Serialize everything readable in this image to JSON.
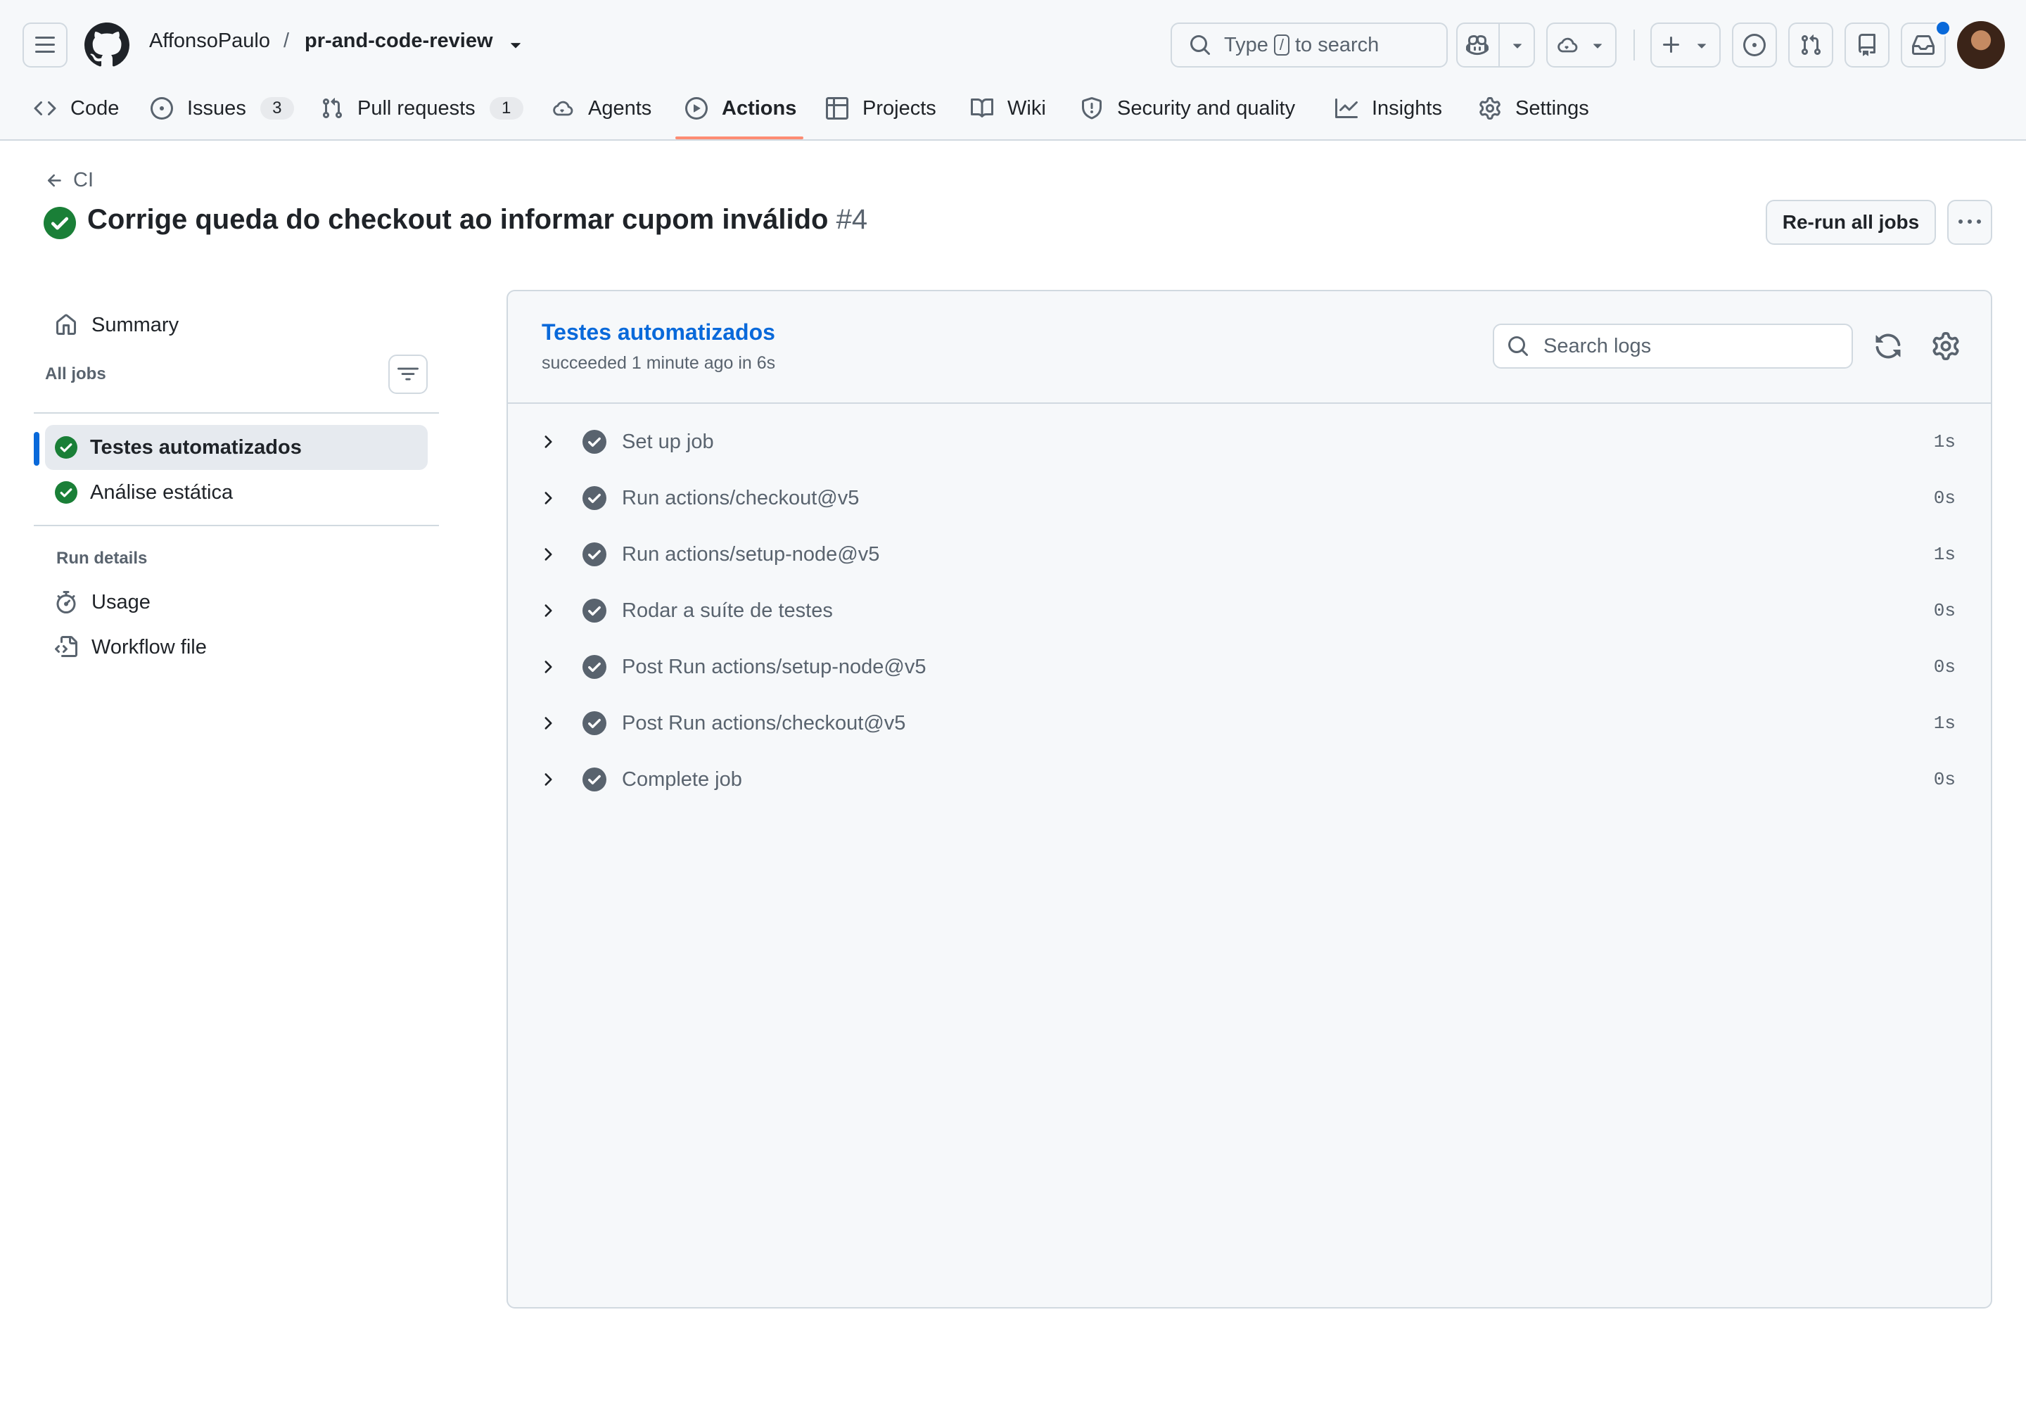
{
  "header": {
    "owner": "AffonsoPaulo",
    "separator": "/",
    "repo": "pr-and-code-review",
    "search": {
      "prefix": "Type",
      "key": "/",
      "suffix": "to search"
    }
  },
  "nav": {
    "tabs": [
      {
        "id": "code",
        "label": "Code"
      },
      {
        "id": "issues",
        "label": "Issues",
        "count": "3"
      },
      {
        "id": "pulls",
        "label": "Pull requests",
        "count": "1"
      },
      {
        "id": "agents",
        "label": "Agents"
      },
      {
        "id": "actions",
        "label": "Actions",
        "active": true
      },
      {
        "id": "projects",
        "label": "Projects"
      },
      {
        "id": "wiki",
        "label": "Wiki"
      },
      {
        "id": "security",
        "label": "Security and quality"
      },
      {
        "id": "insights",
        "label": "Insights"
      },
      {
        "id": "settings",
        "label": "Settings"
      }
    ]
  },
  "run": {
    "back_label": "CI",
    "title": "Corrige queda do checkout ao informar cupom inválido",
    "number": "#4",
    "rerun_label": "Re-run all jobs"
  },
  "sidebar": {
    "summary_label": "Summary",
    "all_jobs_label": "All jobs",
    "jobs": [
      {
        "label": "Testes automatizados",
        "status": "success",
        "selected": true
      },
      {
        "label": "Análise estática",
        "status": "success"
      }
    ],
    "run_details_label": "Run details",
    "details": [
      {
        "label": "Usage",
        "icon": "stopwatch-icon"
      },
      {
        "label": "Workflow file",
        "icon": "file-code-icon"
      }
    ]
  },
  "job": {
    "title": "Testes automatizados",
    "status_text": "succeeded 1 minute ago in 6s",
    "search_placeholder": "Search logs",
    "steps": [
      {
        "name": "Set up job",
        "duration": "1s"
      },
      {
        "name": "Run actions/checkout@v5",
        "duration": "0s"
      },
      {
        "name": "Run actions/setup-node@v5",
        "duration": "1s"
      },
      {
        "name": "Rodar a suíte de testes",
        "duration": "0s"
      },
      {
        "name": "Post Run actions/setup-node@v5",
        "duration": "0s"
      },
      {
        "name": "Post Run actions/checkout@v5",
        "duration": "1s"
      },
      {
        "name": "Complete job",
        "duration": "0s"
      }
    ]
  },
  "colors": {
    "accent": "#0969da",
    "success": "#1a7f37",
    "step_success": "#59636e",
    "tab_underline": "#fd8c73",
    "header_bg": "#f6f8fa"
  }
}
